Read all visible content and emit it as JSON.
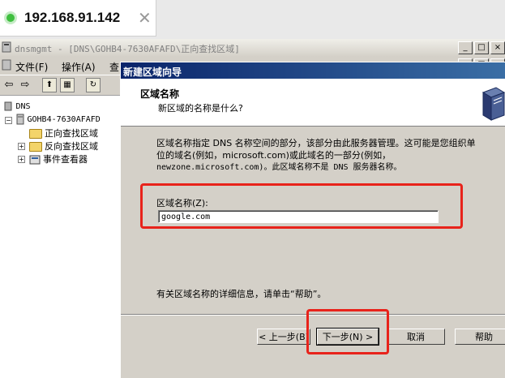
{
  "remote_tab": {
    "title": "192.168.91.142",
    "close_glyph": "✕"
  },
  "mmc": {
    "title": "dnsmgmt - [DNS\\GOHB4-7630AFAFD\\正向查找区域]",
    "window_buttons": [
      "_",
      "□",
      "×"
    ],
    "menu": [
      "文件(F)",
      "操作(A)",
      "查"
    ],
    "toolbar": [
      "⇦",
      "⇨",
      "⬆",
      "▦",
      "↻"
    ]
  },
  "tree": {
    "root": "DNS",
    "server": "GOHB4-7630AFAFD",
    "items": [
      "正向查找区域",
      "反向查找区域",
      "事件查看器"
    ]
  },
  "wizard": {
    "title": "新建区域向导",
    "header_title": "区域名称",
    "header_subtitle": "新区域的名称是什么?",
    "desc_line1": "区域名称指定 DNS 名称空间的部分，该部分由此服务器管理。这可能是您组织单",
    "desc_line2": "位的域名(例如，microsoft.com)或此域名的一部分(例如，",
    "desc_line3": "newzone.microsoft.com)。此区域名称不是 DNS 服务器名称。",
    "zone_label": "区域名称(Z):",
    "zone_value": "google.com",
    "help_text": "有关区域名称的详细信息，请单击“帮助”。",
    "buttons": {
      "back": "< 上一步(B)",
      "next": "下一步(N) >",
      "cancel": "取消",
      "help": "帮助"
    }
  },
  "colors": {
    "highlight_box": "#e8231b",
    "title_bar": "#0a246a"
  }
}
